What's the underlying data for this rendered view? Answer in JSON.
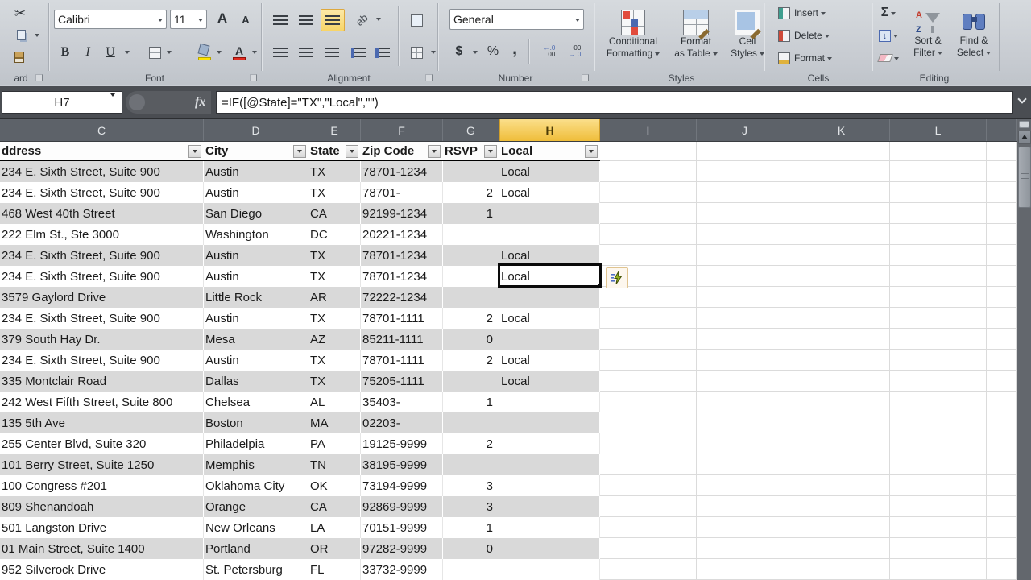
{
  "colors": {
    "active_column_yellow": "#efbd39",
    "band_gray": "#d9d9d9",
    "selection_black": "#0a0a0a",
    "header_strip": "#5d6269",
    "highlight_button": "#f8d567"
  },
  "ribbon": {
    "clipboard": {
      "group_label": "ard"
    },
    "font": {
      "group_label": "Font",
      "family": "Calibri",
      "size": "11",
      "bold": "B",
      "italic": "I",
      "underline": "U",
      "grow": "A",
      "shrink": "A"
    },
    "alignment": {
      "group_label": "Alignment",
      "orientation": "ab"
    },
    "number": {
      "group_label": "Number",
      "format": "General",
      "currency": "$",
      "percent": "%",
      "comma": ",",
      "inc_top": "←.0",
      "inc_bot": ".00",
      "dec_top": ".00",
      "dec_bot": "→.0"
    },
    "styles": {
      "group_label": "Styles",
      "cf_line1": "Conditional",
      "cf_line2": "Formatting",
      "ft_line1": "Format",
      "ft_line2": "as Table",
      "cs_line1": "Cell",
      "cs_line2": "Styles"
    },
    "cells": {
      "group_label": "Cells",
      "insert": "Insert",
      "delete": "Delete",
      "format": "Format"
    },
    "editing": {
      "group_label": "Editing",
      "autosum": "Σ",
      "sort_line1": "Sort &",
      "sort_line2": "Filter",
      "find_line1": "Find &",
      "find_line2": "Select",
      "az_a": "A",
      "az_z": "Z"
    },
    "icons": {
      "scissors": "✂",
      "fx": "fx"
    }
  },
  "formula_bar": {
    "name_box": "H7",
    "fx": "fx",
    "formula": "=IF([@State]=\"TX\",\"Local\",\"\")"
  },
  "columns": {
    "letters": [
      "C",
      "D",
      "E",
      "F",
      "G",
      "H",
      "I",
      "J",
      "K",
      "L"
    ],
    "active": "H"
  },
  "sheet": {
    "headers": [
      "ddress",
      "City",
      "State",
      "Zip Code",
      "RSVP",
      "Local"
    ],
    "selection": {
      "cell": "H7",
      "row_index": 5,
      "value": "Local"
    },
    "rows": [
      {
        "address": "234 E. Sixth Street, Suite 900",
        "city": "Austin",
        "state": "TX",
        "zip": "78701-1234",
        "rsvp": "",
        "local": "Local"
      },
      {
        "address": "234 E. Sixth Street, Suite 900",
        "city": "Austin",
        "state": "TX",
        "zip": "78701-",
        "rsvp": "2",
        "local": "Local"
      },
      {
        "address": "468 West 40th Street",
        "city": "San Diego",
        "state": "CA",
        "zip": "92199-1234",
        "rsvp": "1",
        "local": ""
      },
      {
        "address": "222 Elm St., Ste 3000",
        "city": "Washington",
        "state": "DC",
        "zip": "20221-1234",
        "rsvp": "",
        "local": ""
      },
      {
        "address": "234 E. Sixth Street, Suite 900",
        "city": "Austin",
        "state": "TX",
        "zip": "78701-1234",
        "rsvp": "",
        "local": "Local"
      },
      {
        "address": "234 E. Sixth Street, Suite 900",
        "city": "Austin",
        "state": "TX",
        "zip": "78701-1234",
        "rsvp": "",
        "local": "Local"
      },
      {
        "address": "3579 Gaylord Drive",
        "city": "Little Rock",
        "state": "AR",
        "zip": "72222-1234",
        "rsvp": "",
        "local": ""
      },
      {
        "address": "234 E. Sixth Street, Suite 900",
        "city": "Austin",
        "state": "TX",
        "zip": "78701-1111",
        "rsvp": "2",
        "local": "Local"
      },
      {
        "address": "379 South Hay Dr.",
        "city": "Mesa",
        "state": "AZ",
        "zip": "85211-1111",
        "rsvp": "0",
        "local": ""
      },
      {
        "address": "234 E. Sixth Street, Suite 900",
        "city": "Austin",
        "state": "TX",
        "zip": "78701-1111",
        "rsvp": "2",
        "local": "Local"
      },
      {
        "address": "335 Montclair Road",
        "city": "Dallas",
        "state": "TX",
        "zip": "75205-1111",
        "rsvp": "",
        "local": "Local"
      },
      {
        "address": "242 West Fifth Street, Suite 800",
        "city": "Chelsea",
        "state": "AL",
        "zip": "35403-",
        "rsvp": "1",
        "local": ""
      },
      {
        "address": "135 5th Ave",
        "city": "Boston",
        "state": "MA",
        "zip": "02203-",
        "rsvp": "",
        "local": ""
      },
      {
        "address": "255 Center Blvd, Suite 320",
        "city": "Philadelpia",
        "state": "PA",
        "zip": "19125-9999",
        "rsvp": "2",
        "local": ""
      },
      {
        "address": "101 Berry Street, Suite 1250",
        "city": "Memphis",
        "state": "TN",
        "zip": "38195-9999",
        "rsvp": "",
        "local": ""
      },
      {
        "address": "100 Congress #201",
        "city": "Oklahoma City",
        "state": "OK",
        "zip": "73194-9999",
        "rsvp": "3",
        "local": ""
      },
      {
        "address": "809 Shenandoah",
        "city": "Orange",
        "state": "CA",
        "zip": "92869-9999",
        "rsvp": "3",
        "local": ""
      },
      {
        "address": "501 Langston Drive",
        "city": "New Orleans",
        "state": "LA",
        "zip": "70151-9999",
        "rsvp": "1",
        "local": ""
      },
      {
        "address": "01 Main Street, Suite 1400",
        "city": "Portland",
        "state": "OR",
        "zip": "97282-9999",
        "rsvp": "0",
        "local": ""
      },
      {
        "address": "952 Silverock Drive",
        "city": "St. Petersburg",
        "state": "FL",
        "zip": "33732-9999",
        "rsvp": "",
        "local": ""
      }
    ]
  }
}
